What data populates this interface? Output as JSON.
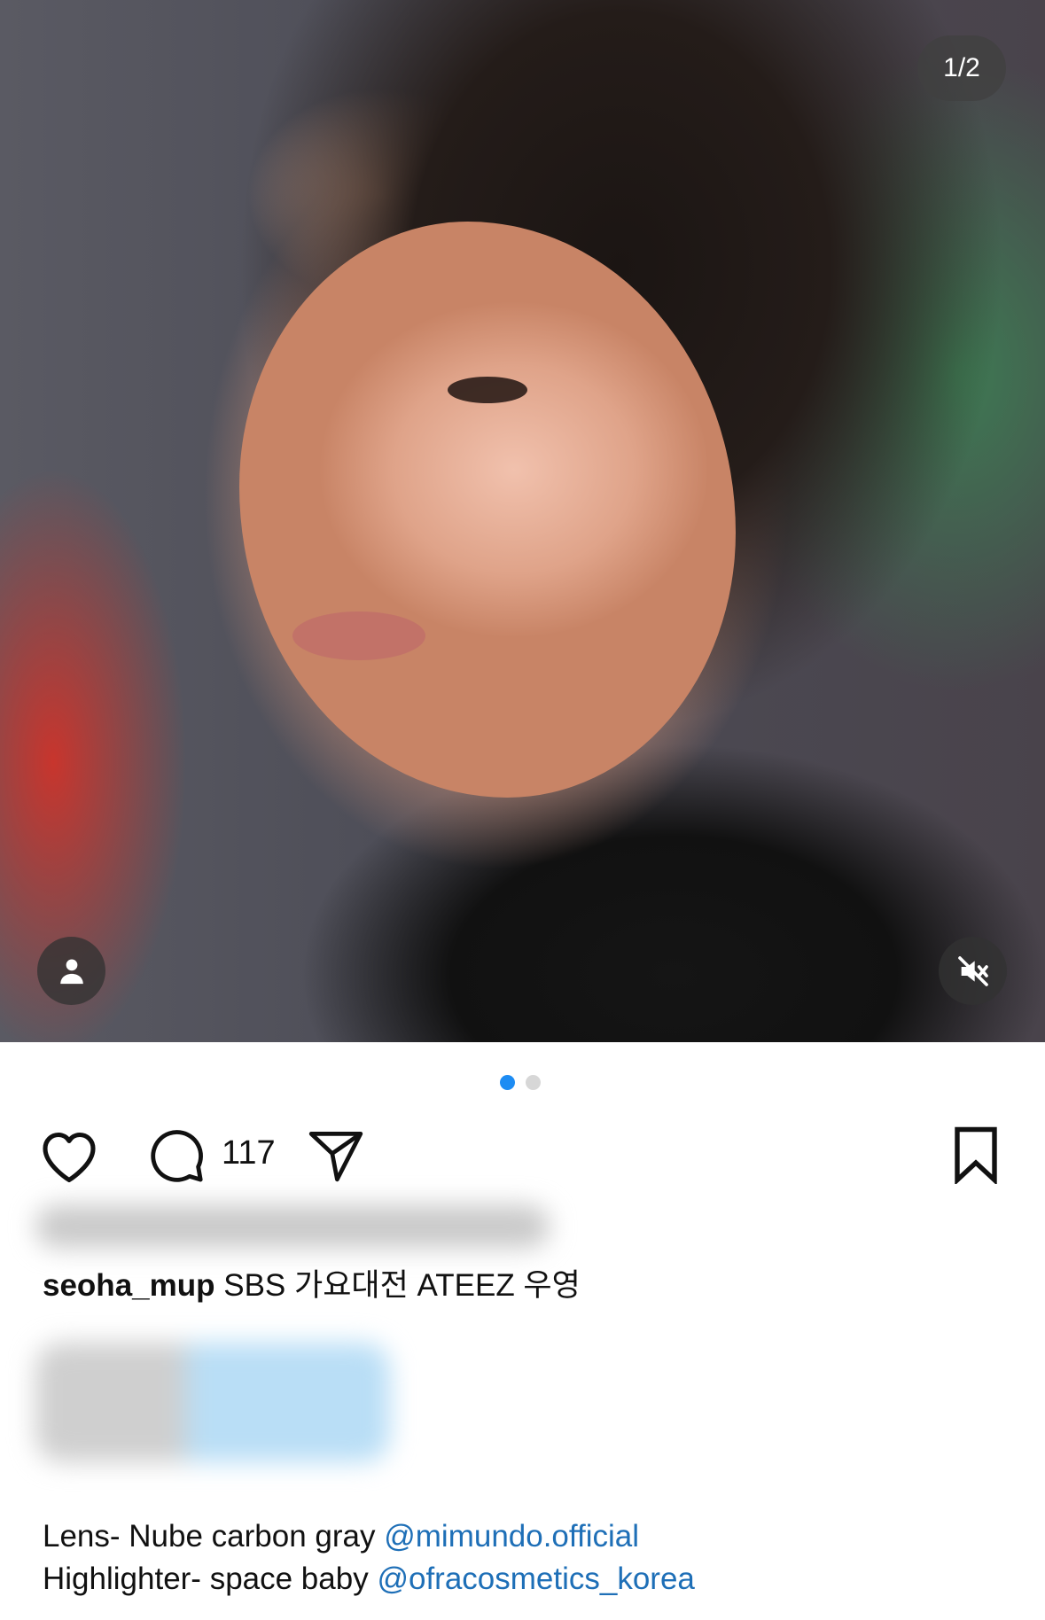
{
  "media": {
    "counter": "1/2",
    "user_tag_icon": "person-icon",
    "mute_icon": "speaker-muted-icon",
    "page_dots": {
      "active_color": "#1d8cf3",
      "inactive_color": "#d7d7d7",
      "active_index": 0,
      "total": 2
    }
  },
  "actions": {
    "like_icon": "heart-icon",
    "comment_icon": "comment-bubble-icon",
    "comment_count": "117",
    "share_icon": "paper-plane-icon",
    "save_icon": "bookmark-icon"
  },
  "caption": {
    "username": "seoha_mup",
    "text": "SBS 가요대전 ATEEZ 우영"
  },
  "details": [
    {
      "text": "Lens- Nube carbon gray",
      "mention": "@mimundo.official"
    },
    {
      "text": "Highlighter- space baby",
      "mention": "@ofracosmetics_korea"
    }
  ],
  "colors": {
    "link": "#1e6fb7",
    "text": "#111111"
  }
}
